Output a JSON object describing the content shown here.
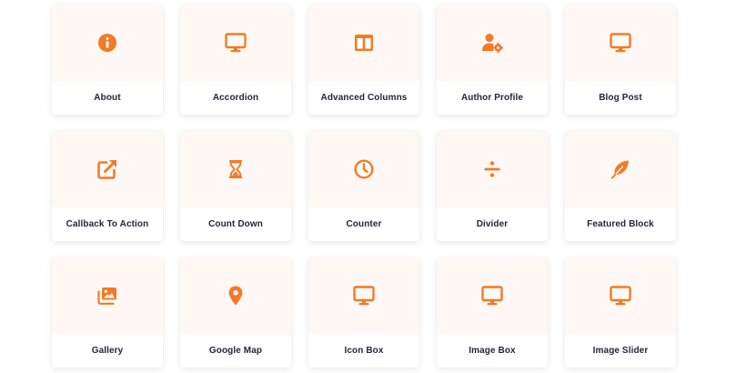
{
  "accent_color": "#f47a26",
  "widgets": [
    {
      "label": "About",
      "icon": "info-icon"
    },
    {
      "label": "Accordion",
      "icon": "monitor-icon"
    },
    {
      "label": "Advanced Columns",
      "icon": "columns-icon"
    },
    {
      "label": "Author Profile",
      "icon": "user-gear-icon"
    },
    {
      "label": "Blog Post",
      "icon": "monitor-icon"
    },
    {
      "label": "Callback To Action",
      "icon": "external-link-icon"
    },
    {
      "label": "Count Down",
      "icon": "hourglass-icon"
    },
    {
      "label": "Counter",
      "icon": "clock-icon"
    },
    {
      "label": "Divider",
      "icon": "divide-icon"
    },
    {
      "label": "Featured Block",
      "icon": "feather-icon"
    },
    {
      "label": "Gallery",
      "icon": "images-icon"
    },
    {
      "label": "Google Map",
      "icon": "map-pin-icon"
    },
    {
      "label": "Icon Box",
      "icon": "monitor-icon"
    },
    {
      "label": "Image Box",
      "icon": "monitor-icon"
    },
    {
      "label": "Image Slider",
      "icon": "monitor-icon"
    }
  ]
}
